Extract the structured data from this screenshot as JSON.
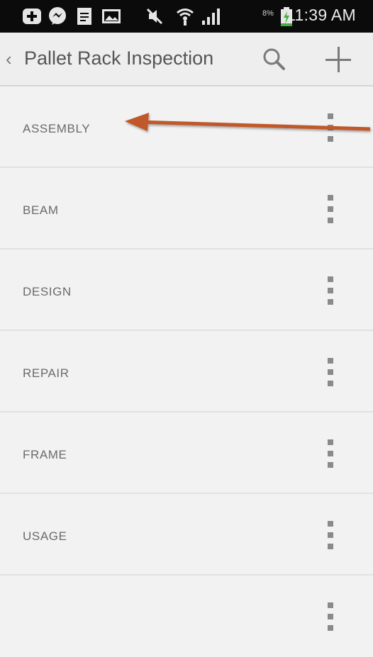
{
  "status_bar": {
    "time": "11:39 AM",
    "battery_percent": "8%",
    "icons": [
      "add-icon",
      "messenger-icon",
      "document-icon",
      "image-icon",
      "mute-icon",
      "wifi-icon",
      "signal-icon",
      "battery-charging-icon"
    ]
  },
  "action_bar": {
    "back_glyph": "‹",
    "title": "Pallet Rack Inspection",
    "actions": [
      "search-icon",
      "add-icon"
    ]
  },
  "list": {
    "items": [
      {
        "label": "ASSEMBLY"
      },
      {
        "label": "BEAM"
      },
      {
        "label": "DESIGN"
      },
      {
        "label": "REPAIR"
      },
      {
        "label": "FRAME"
      },
      {
        "label": "USAGE"
      },
      {
        "label": ""
      }
    ]
  },
  "annotation": {
    "arrow_color": "#c0582a"
  }
}
